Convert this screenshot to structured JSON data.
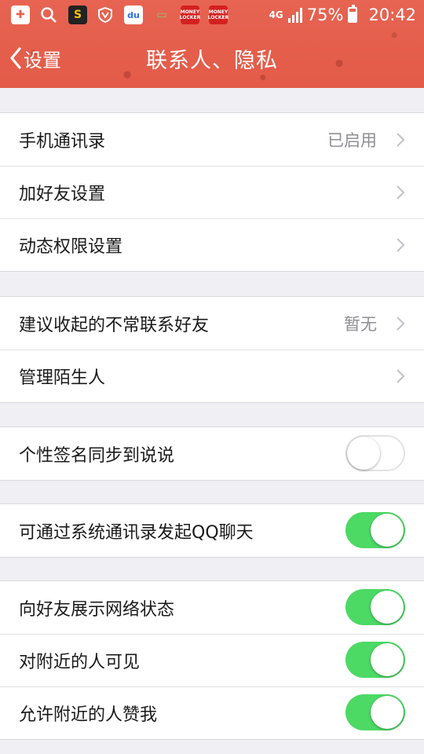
{
  "status_bar": {
    "network": "4G",
    "battery_percent": "75%",
    "battery_level": 0.75,
    "time": "20:42",
    "notification_icons": [
      "plus-square-icon",
      "search-icon",
      "s-app-icon",
      "shield-v-icon",
      "baidu-paw-icon",
      "chat-icon",
      "money-locker-icon",
      "money-locker-icon"
    ]
  },
  "nav": {
    "back_label": "设置",
    "title": "联系人、隐私"
  },
  "groups": [
    {
      "rows": [
        {
          "label": "手机通讯录",
          "value": "已启用",
          "type": "link"
        },
        {
          "label": "加好友设置",
          "value": "",
          "type": "link"
        },
        {
          "label": "动态权限设置",
          "value": "",
          "type": "link"
        }
      ]
    },
    {
      "rows": [
        {
          "label": "建议收起的不常联系好友",
          "value": "暂无",
          "type": "link"
        },
        {
          "label": "管理陌生人",
          "value": "",
          "type": "link"
        }
      ]
    },
    {
      "rows": [
        {
          "label": "个性签名同步到说说",
          "type": "toggle",
          "on": false
        }
      ]
    },
    {
      "rows": [
        {
          "label": "可通过系统通讯录发起QQ聊天",
          "type": "toggle",
          "on": true
        }
      ]
    },
    {
      "rows": [
        {
          "label": "向好友展示网络状态",
          "type": "toggle",
          "on": true
        },
        {
          "label": "对附近的人可见",
          "type": "toggle",
          "on": true
        },
        {
          "label": "允许附近的人赞我",
          "type": "toggle",
          "on": true
        }
      ]
    }
  ],
  "colors": {
    "header": "#e8604f",
    "toggle_on": "#4cd964",
    "background": "#efeff4"
  }
}
